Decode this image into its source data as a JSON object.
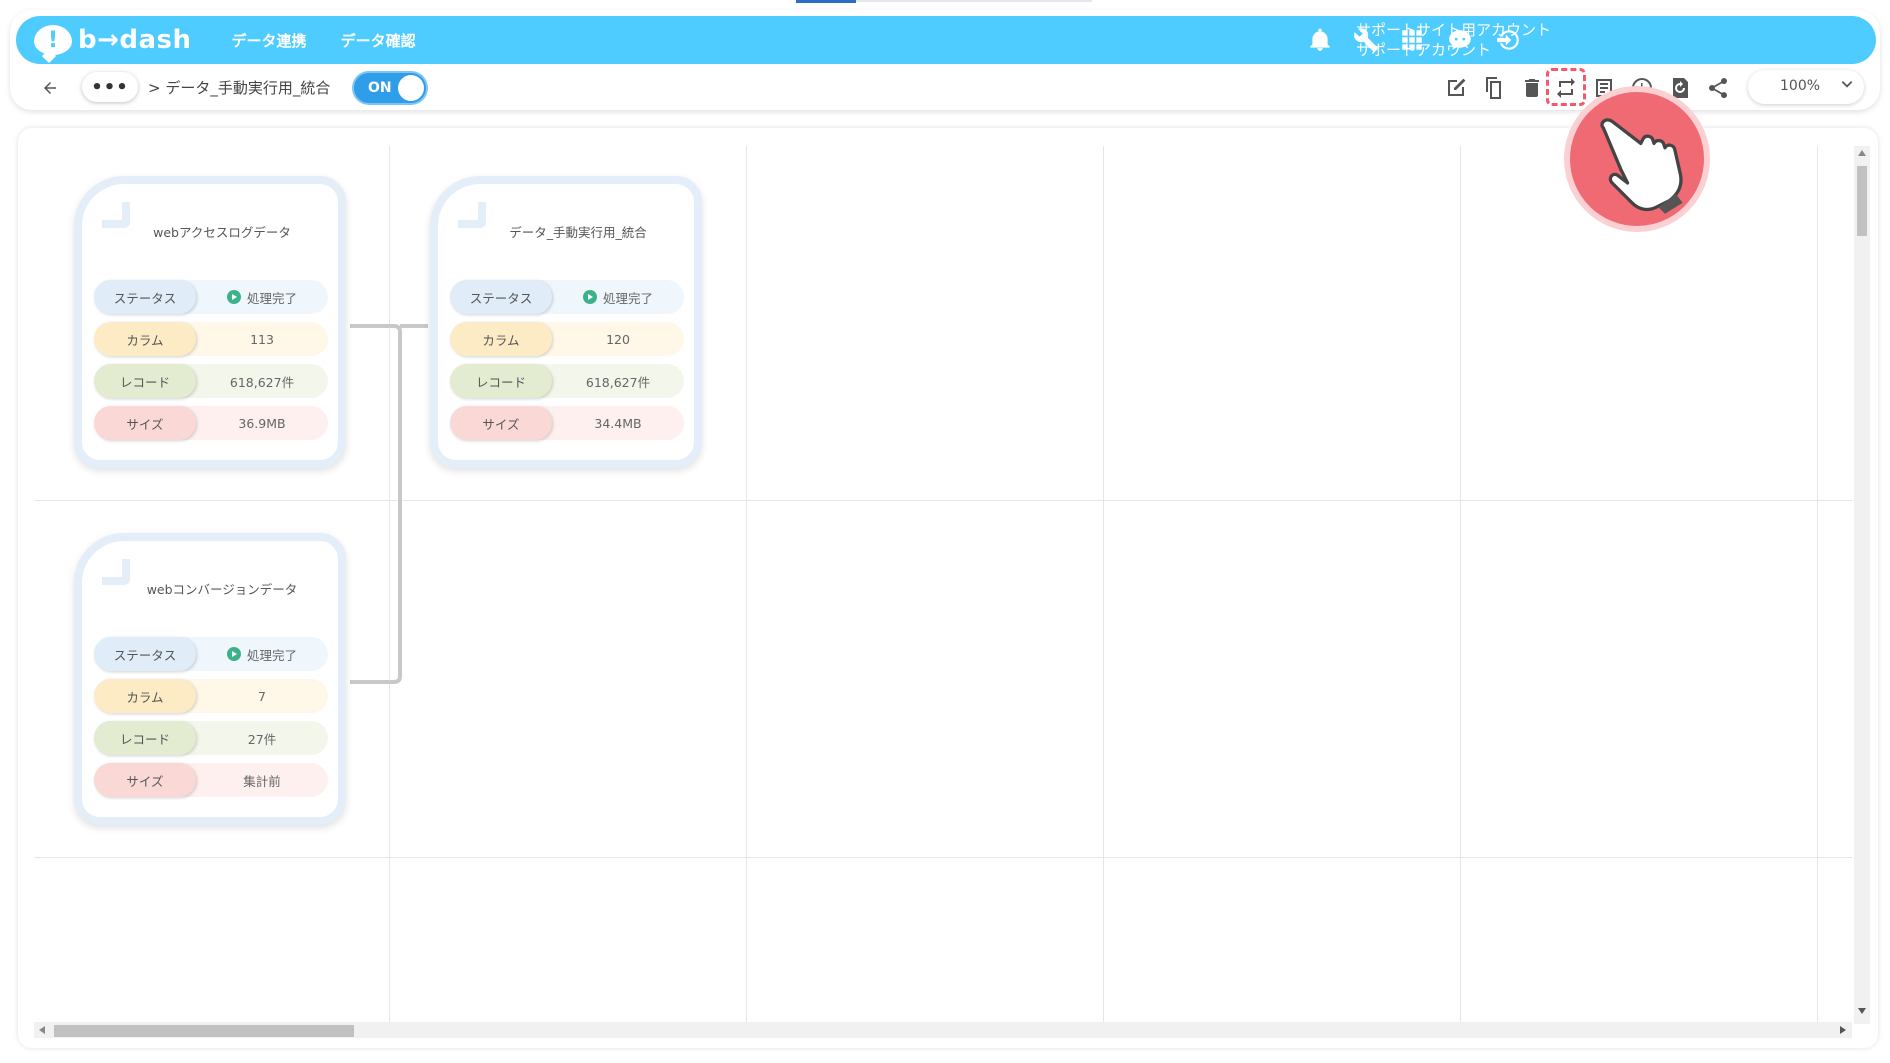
{
  "header": {
    "logo_text": "b→dash",
    "nav": [
      "データ連携",
      "データ確認"
    ],
    "account_line1": "サポートサイト用アカウント",
    "account_line2": "サポートアカウント"
  },
  "toolbar": {
    "more_label": "•••",
    "breadcrumb": "> データ_手動実行用_統合",
    "toggle_label": "ON",
    "zoom": "100%"
  },
  "nodes": [
    {
      "title": "webアクセスログデータ",
      "status_key": "ステータス",
      "status_val": "処理完了",
      "col_key": "カラム",
      "col_val": "113",
      "rec_key": "レコード",
      "rec_val": "618,627件",
      "size_key": "サイズ",
      "size_val": "36.9MB"
    },
    {
      "title": "データ_手動実行用_統合",
      "status_key": "ステータス",
      "status_val": "処理完了",
      "col_key": "カラム",
      "col_val": "120",
      "rec_key": "レコード",
      "rec_val": "618,627件",
      "size_key": "サイズ",
      "size_val": "34.4MB"
    },
    {
      "title": "webコンバージョンデータ",
      "status_key": "ステータス",
      "status_val": "処理完了",
      "col_key": "カラム",
      "col_val": "7",
      "rec_key": "レコード",
      "rec_val": "27件",
      "size_key": "サイズ",
      "size_val": "集計前"
    }
  ],
  "colors": {
    "header_bg": "#4ecbff",
    "toggle_bg": "#2f9de8",
    "highlight": "#f25a6b",
    "status_ok": "#3cb28a"
  },
  "icons": [
    "bell-icon",
    "wrench-icon",
    "apps-grid-icon",
    "chat-bot-icon",
    "logout-icon",
    "edit-icon",
    "copy-icon",
    "trash-icon",
    "swap-icon",
    "list-icon",
    "clock-icon",
    "refresh-icon",
    "share-icon",
    "pointer-hand-icon"
  ]
}
